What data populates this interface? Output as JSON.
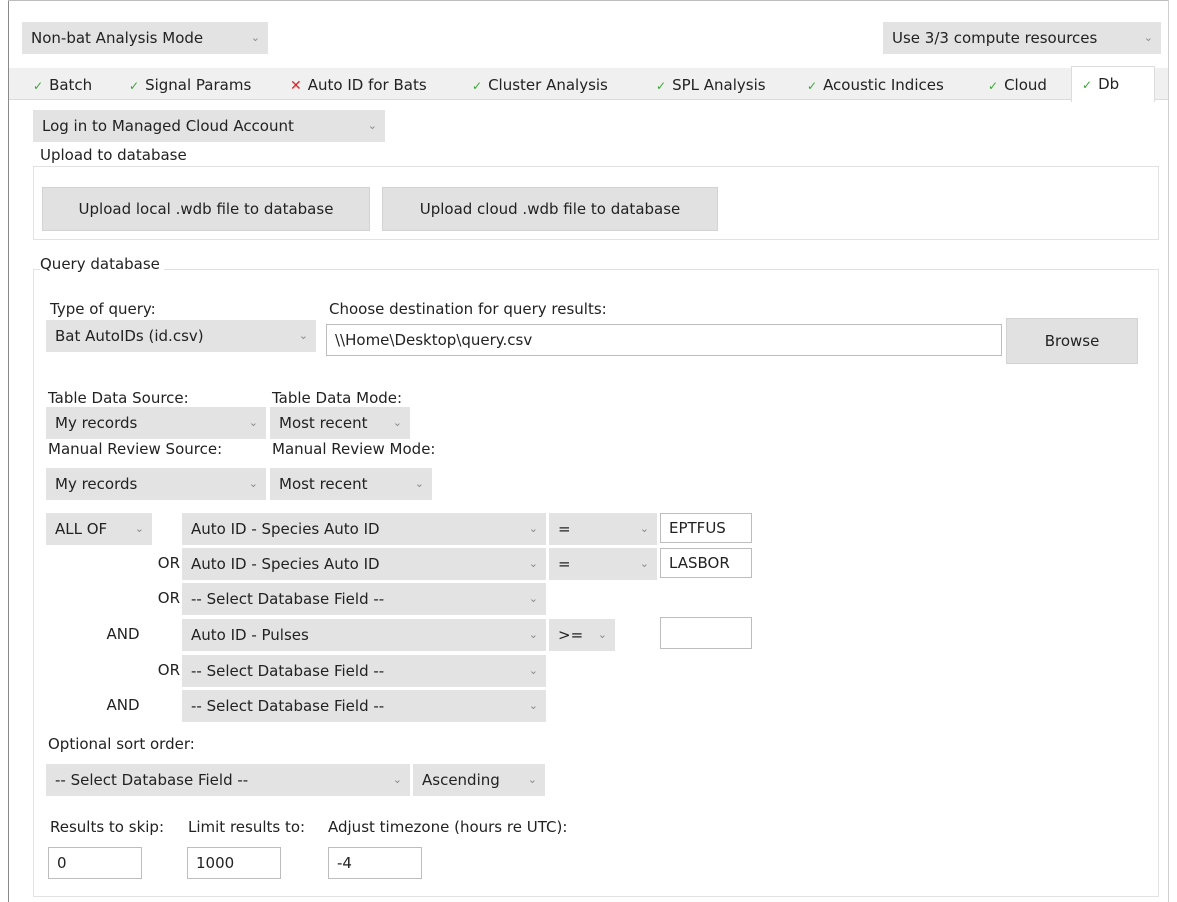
{
  "mode_dropdown": "Non-bat Analysis Mode",
  "resources_dropdown": "Use 3/3 compute resources",
  "tabs": [
    {
      "label": "Batch",
      "status": "ok"
    },
    {
      "label": "Signal Params",
      "status": "ok"
    },
    {
      "label": "Auto ID for Bats",
      "status": "error"
    },
    {
      "label": "Cluster Analysis",
      "status": "ok"
    },
    {
      "label": "SPL Analysis",
      "status": "ok"
    },
    {
      "label": "Acoustic Indices",
      "status": "ok"
    },
    {
      "label": "Cloud",
      "status": "ok"
    },
    {
      "label": "Db",
      "status": "ok"
    }
  ],
  "status_icons": {
    "ok": "✓",
    "error": "✕"
  },
  "account_dropdown": "Log in to Managed Cloud Account",
  "upload": {
    "title": "Upload to database",
    "local_button": "Upload local .wdb file to database",
    "cloud_button": "Upload cloud .wdb file to database"
  },
  "query": {
    "title": "Query database",
    "type_label": "Type of query:",
    "type_value": "Bat AutoIDs (id.csv)",
    "dest_label": "Choose destination for query results:",
    "dest_value": "\\\\Home\\Desktop\\query.csv",
    "browse_button": "Browse",
    "table_source_label": "Table Data Source:",
    "table_source_value": "My records",
    "table_mode_label": "Table Data Mode:",
    "table_mode_value": "Most recent",
    "review_source_label": "Manual Review Source:",
    "review_source_value": "My records",
    "review_mode_label": "Manual Review Mode:",
    "review_mode_value": "Most recent",
    "match_dropdown": "ALL OF",
    "conditions": [
      {
        "connector": "",
        "field": "Auto ID - Species Auto ID",
        "operator": "=",
        "value": "EPTFUS"
      },
      {
        "connector": "OR",
        "field": "Auto ID - Species Auto ID",
        "operator": "=",
        "value": "LASBOR"
      },
      {
        "connector": "OR",
        "field": "-- Select Database Field --"
      },
      {
        "connector": "AND",
        "field": "Auto ID - Pulses",
        "operator": ">=",
        "value": ""
      },
      {
        "connector": "OR",
        "field": "-- Select Database Field --"
      },
      {
        "connector": "AND",
        "field": "-- Select Database Field --"
      }
    ],
    "sort_label": "Optional sort order:",
    "sort_field": "-- Select Database Field --",
    "sort_direction": "Ascending",
    "skip_label": "Results to skip:",
    "skip_value": "0",
    "limit_label": "Limit results to:",
    "limit_value": "1000",
    "timezone_label": "Adjust timezone (hours re UTC):",
    "timezone_value": "-4"
  }
}
